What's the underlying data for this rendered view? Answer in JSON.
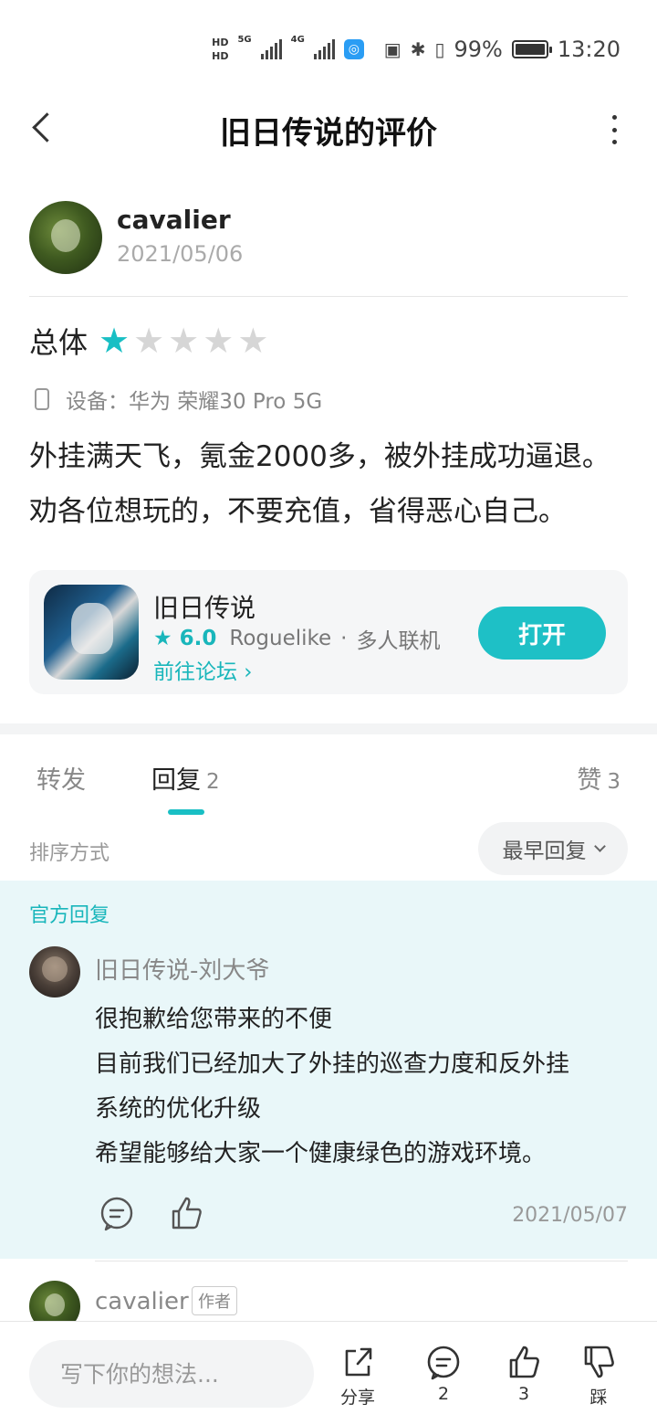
{
  "status_bar": {
    "hd1": "HD",
    "hd2": "HD",
    "net1": "5G",
    "net2": "4G",
    "battery_percent": "99%",
    "battery_level": 0.99,
    "time": "13:20"
  },
  "nav": {
    "title": "旧日传说的评价"
  },
  "review": {
    "author_name": "cavalier",
    "date": "2021/05/06",
    "rating_label": "总体",
    "rating": 1,
    "rating_max": 5,
    "device": "设备：华为 荣耀30 Pro 5G",
    "content_line1": "外挂满天飞，氪金2000多，被外挂成功逼退。",
    "content_line2": "劝各位想玩的，不要充值，省得恶心自己。"
  },
  "app_card": {
    "name": "旧日传说",
    "score": "6.0",
    "tag1": "Roguelike",
    "separator": "·",
    "tag2": "多人联机",
    "forum_link": "前往论坛 ›",
    "open_button": "打开"
  },
  "tabs": {
    "forward": "转发",
    "reply": "回复",
    "reply_count": "2",
    "like": "赞",
    "like_count": "3"
  },
  "sort": {
    "label": "排序方式",
    "value": "最早回复"
  },
  "official_reply": {
    "section_title": "官方回复",
    "author": "旧日传说-刘大爷",
    "line1": "很抱歉给您带来的不便",
    "line2": "目前我们已经加大了外挂的巡查力度和反外挂",
    "line3": "系统的优化升级",
    "line4": "希望能够给大家一个健康绿色的游戏环境。",
    "date": "2021/05/07"
  },
  "second_reply": {
    "author": "cavalier",
    "tag": "作者"
  },
  "bottom_bar": {
    "input_placeholder": "写下你的想法...",
    "share_label": "分享",
    "comment_count": "2",
    "like_count": "3",
    "dislike_label": "踩"
  },
  "colors": {
    "accent": "#19bfc4",
    "official_bg": "#e9f7f9"
  }
}
